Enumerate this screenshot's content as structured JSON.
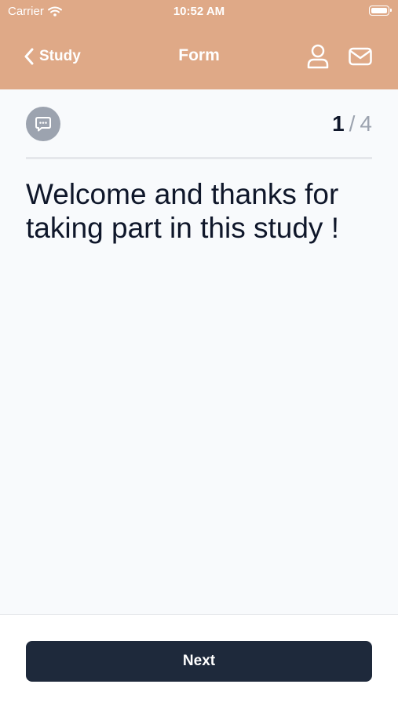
{
  "status_bar": {
    "carrier": "Carrier",
    "time": "10:52 AM",
    "wifi_icon": "wifi-icon",
    "battery_icon": "battery-icon"
  },
  "nav": {
    "back_label": "Study",
    "back_icon": "chevron-left-icon",
    "title": "Form",
    "profile_icon": "user-icon",
    "mail_icon": "mail-icon"
  },
  "form": {
    "type_icon": "chat-bubble-icon",
    "progress": {
      "current": "1",
      "separator": "/",
      "total": "4"
    },
    "question": "Welcome and thanks for taking part in this study !"
  },
  "footer": {
    "next_label": "Next"
  },
  "colors": {
    "header": "#dfa987",
    "background": "#f8fafc",
    "button": "#1e293b",
    "badge": "#9ca3af"
  }
}
